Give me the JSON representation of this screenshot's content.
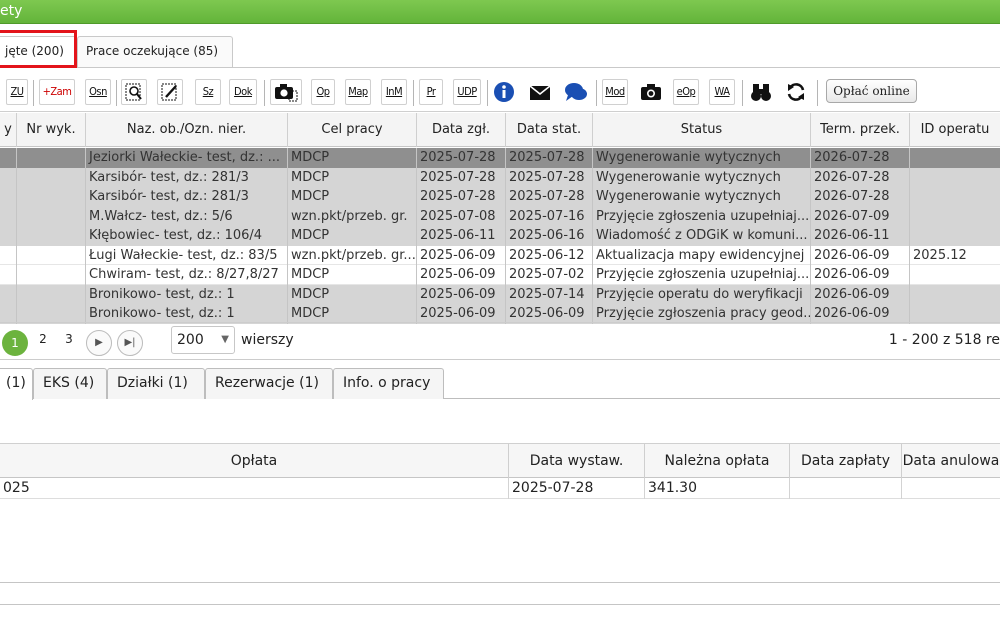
{
  "window": {
    "title_fragment": "ety"
  },
  "top_tabs": [
    {
      "label": "jęte (200)"
    },
    {
      "label": "Prace oczekujące (85)"
    }
  ],
  "toolbar": {
    "buttons": [
      "ZU",
      "+Zam",
      "Osn",
      "magnify-doc",
      "edit-doc",
      "Sz",
      "Dok",
      "camera-doc",
      "Op",
      "Map",
      "InM",
      "Pr",
      "UDP",
      "info",
      "mail",
      "chat",
      "Mod",
      "camera",
      "eOp",
      "WA",
      "binoculars",
      "refresh"
    ],
    "pay_online": "Opłać  online"
  },
  "grid": {
    "columns": [
      "y",
      "Nr wyk.",
      "Naz. ob./Ozn. nier.",
      "Cel pracy",
      "Data zgł.",
      "Data stat.",
      "Status",
      "Term. przek.",
      "ID operatu"
    ],
    "rows": [
      {
        "naz": "Jeziorki Wałeckie- test, dz.: ...",
        "cel": "MDCP",
        "zgl": "2025-07-28",
        "stat": "2025-07-28",
        "status": "Wygenerowanie wytycznych",
        "term": "2026-07-28",
        "id": "",
        "style": "dark"
      },
      {
        "naz": "Karsibór- test, dz.: 281/3",
        "cel": "MDCP",
        "zgl": "2025-07-28",
        "stat": "2025-07-28",
        "status": "Wygenerowanie wytycznych",
        "term": "2026-07-28",
        "id": "",
        "style": "g"
      },
      {
        "naz": "Karsibór- test, dz.: 281/3",
        "cel": "MDCP",
        "zgl": "2025-07-28",
        "stat": "2025-07-28",
        "status": "Wygenerowanie wytycznych",
        "term": "2026-07-28",
        "id": "",
        "style": "g"
      },
      {
        "naz": "M.Wałcz- test, dz.: 5/6",
        "cel": "wzn.pkt/przeb. gr.",
        "zgl": "2025-07-08",
        "stat": "2025-07-16",
        "status": "Przyjęcie zgłoszenia uzupełniaj...",
        "term": "2026-07-09",
        "id": "",
        "style": "g"
      },
      {
        "naz": "Kłębowiec- test, dz.: 106/4",
        "cel": "MDCP",
        "zgl": "2025-06-11",
        "stat": "2025-06-16",
        "status": "Wiadomość z ODGiK w komuni...",
        "term": "2026-06-11",
        "id": "",
        "style": "g"
      },
      {
        "naz": "Ługi Wałeckie- test, dz.: 83/5",
        "cel": "wzn.pkt/przeb. gr...",
        "zgl": "2025-06-09",
        "stat": "2025-06-12",
        "status": "Aktualizacja mapy ewidencyjnej",
        "term": "2026-06-09",
        "id": "2025.12",
        "style": "w"
      },
      {
        "naz": "Chwiram- test, dz.: 8/27,8/27",
        "cel": "MDCP",
        "zgl": "2025-06-09",
        "stat": "2025-07-02",
        "status": "Przyjęcie zgłoszenia uzupełniaj...",
        "term": "2026-06-09",
        "id": "",
        "style": "w"
      },
      {
        "naz": "Bronikowo- test, dz.: 1",
        "cel": "MDCP",
        "zgl": "2025-06-09",
        "stat": "2025-07-14",
        "status": "Przyjęcie operatu do weryfikacji",
        "term": "2026-06-09",
        "id": "",
        "style": "g"
      },
      {
        "naz": "Bronikowo- test, dz.: 1",
        "cel": "MDCP",
        "zgl": "2025-06-09",
        "stat": "2025-06-09",
        "status": "Przyjęcie zgłoszenia pracy geod...",
        "term": "2026-06-09",
        "id": "",
        "style": "g"
      }
    ]
  },
  "pager": {
    "pages": [
      "1",
      "2",
      "3"
    ],
    "page_size": "200",
    "rows_label": "wierszy",
    "summary": "1 - 200 z 518 re"
  },
  "bottom_tabs": [
    "(1)",
    "EKS (4)",
    "Działki (1)",
    "Rezerwacje (1)",
    "Info. o pracy"
  ],
  "fees": {
    "columns": [
      "Opłata",
      "Data wystaw.",
      "Należna opłata",
      "Data zapłaty",
      "Data anulowa"
    ],
    "row": {
      "oplata": "025",
      "data_wystaw": "2025-07-28",
      "nalezna": "341.30",
      "zaplaty": "",
      "anul": ""
    }
  }
}
